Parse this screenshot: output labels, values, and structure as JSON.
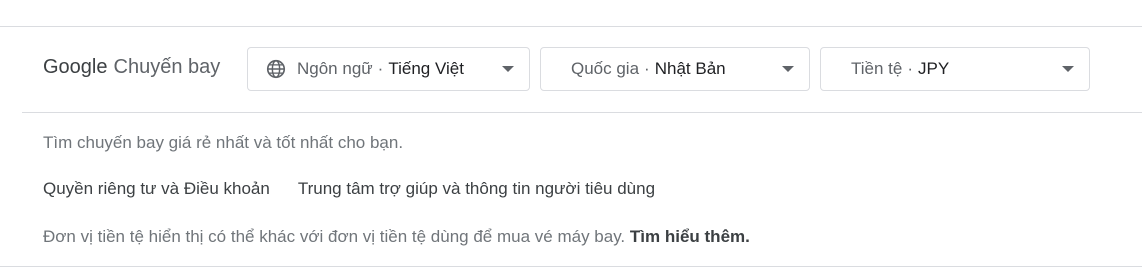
{
  "brand": {
    "google": "Google",
    "product": "Chuyến bay"
  },
  "selectors": {
    "language": {
      "label": "Ngôn ngữ",
      "separator": "·",
      "value": "Tiếng Việt",
      "icon": "globe-icon"
    },
    "country": {
      "label": "Quốc gia",
      "separator": "·",
      "value": "Nhật Bản"
    },
    "currency": {
      "label": "Tiền tệ",
      "separator": "·",
      "value": "JPY"
    }
  },
  "footer": {
    "tagline": "Tìm chuyến bay giá rẻ nhất và tốt nhất cho bạn.",
    "links": {
      "privacy": "Quyền riêng tư và Điều khoản",
      "help": "Trung tâm trợ giúp và thông tin người tiêu dùng"
    },
    "currency_note": "Đơn vị tiền tệ hiển thị có thể khác với đơn vị tiền tệ dùng để mua vé máy bay.",
    "learn_more": "Tìm hiểu thêm."
  },
  "colors": {
    "border": "#dadce0",
    "text": "#3c4043",
    "muted": "#70757a"
  }
}
